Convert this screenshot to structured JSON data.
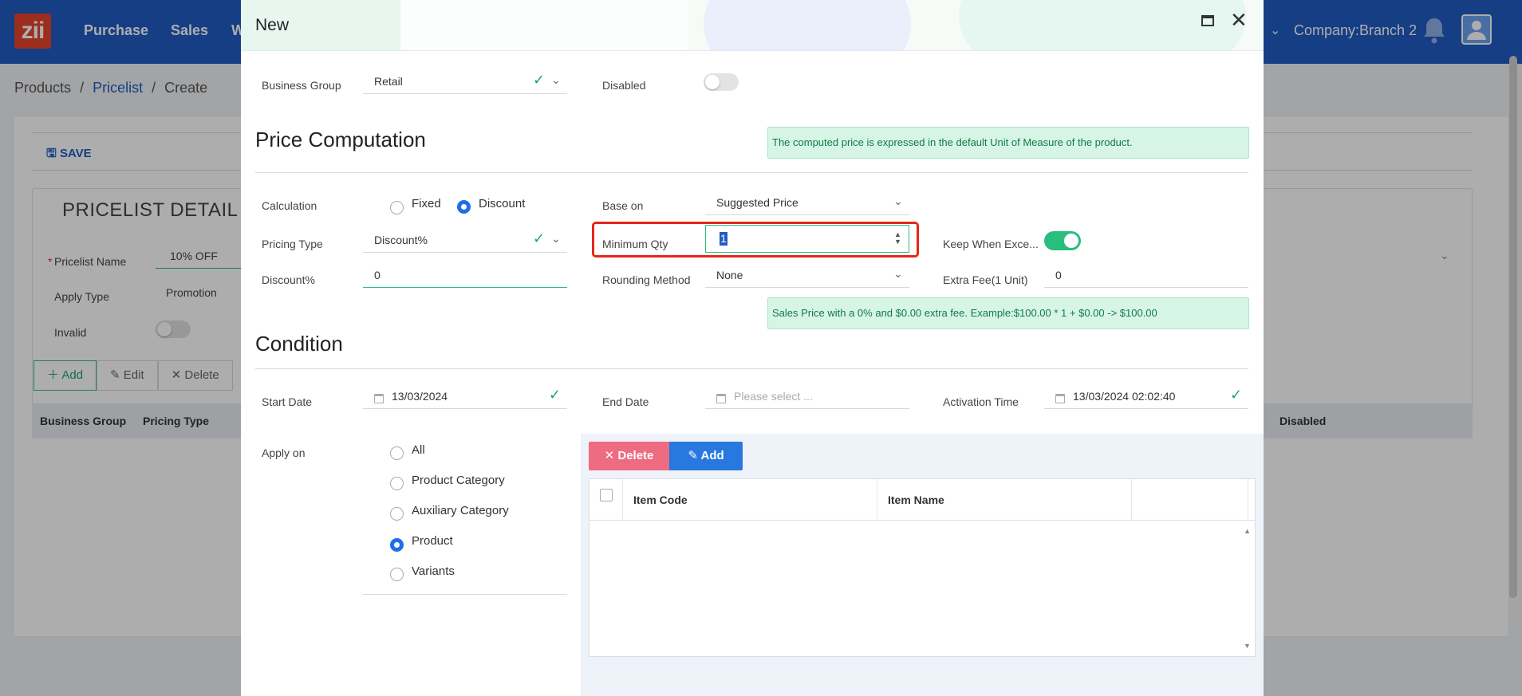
{
  "app": {
    "logo": "zii",
    "nav": [
      "Purchase",
      "Sales",
      "W"
    ],
    "company": "Company:Branch 2"
  },
  "breadcrumb": {
    "root": "Products",
    "sep": "/",
    "link": "Pricelist",
    "current": "Create"
  },
  "page": {
    "save_label": "SAVE",
    "detail_title": "PRICELIST DETAIL",
    "fields": {
      "name_label": "Pricelist Name",
      "name_required": "*",
      "name_value": "10% OFF",
      "apply_type_label": "Apply Type",
      "apply_type_value": "Promotion",
      "invalid_label": "Invalid"
    },
    "actions": {
      "add": "Add",
      "edit": "Edit",
      "delete": "Delete"
    },
    "table_headers": [
      "Business Group",
      "Pricing Type",
      "Disabled"
    ]
  },
  "modal": {
    "title": "New",
    "business_group": {
      "label": "Business Group",
      "value": "Retail"
    },
    "disabled": {
      "label": "Disabled",
      "on": false
    },
    "price_computation": {
      "title": "Price Computation",
      "note": "The computed price is expressed in the default Unit of Measure of the product.",
      "calculation": {
        "label": "Calculation",
        "options": [
          "Fixed",
          "Discount"
        ],
        "selected": "Discount"
      },
      "base_on": {
        "label": "Base on",
        "value": "Suggested Price"
      },
      "pricing_type": {
        "label": "Pricing Type",
        "value": "Discount%"
      },
      "minimum_qty": {
        "label": "Minimum Qty",
        "value": "1"
      },
      "keep_when_exceed": {
        "label": "Keep When Exce...",
        "on": true
      },
      "discount_pct": {
        "label": "Discount%",
        "value": "0"
      },
      "rounding": {
        "label": "Rounding Method",
        "value": "None"
      },
      "extra_fee": {
        "label": "Extra Fee(1 Unit)",
        "value": "0"
      },
      "example_note": "Sales Price with a 0% and $0.00 extra fee. Example:$100.00 * 1 + $0.00 -> $100.00"
    },
    "condition": {
      "title": "Condition",
      "start_date": {
        "label": "Start Date",
        "value": "13/03/2024"
      },
      "end_date": {
        "label": "End Date",
        "placeholder": "Please select ..."
      },
      "activation_time": {
        "label": "Activation Time",
        "value": "13/03/2024 02:02:40"
      },
      "apply_on": {
        "label": "Apply on",
        "options": [
          "All",
          "Product Category",
          "Auxiliary Category",
          "Product",
          "Variants"
        ],
        "selected": "Product"
      },
      "buttons": {
        "delete": "Delete",
        "add": "Add"
      },
      "grid_headers": [
        "Item Code",
        "Item Name"
      ]
    }
  },
  "icons": [
    "bell-icon",
    "user-icon",
    "save-icon",
    "maximize-icon",
    "close-icon",
    "check-icon",
    "chevron-down-icon",
    "calendar-icon",
    "spinner-icon",
    "delete-icon",
    "edit-icon"
  ],
  "colors": {
    "brand": "#1f5cc4",
    "accent_green": "#2bbd7e",
    "danger": "#ee6b82",
    "primary_btn": "#2878e0",
    "highlight": "#e8251a"
  }
}
